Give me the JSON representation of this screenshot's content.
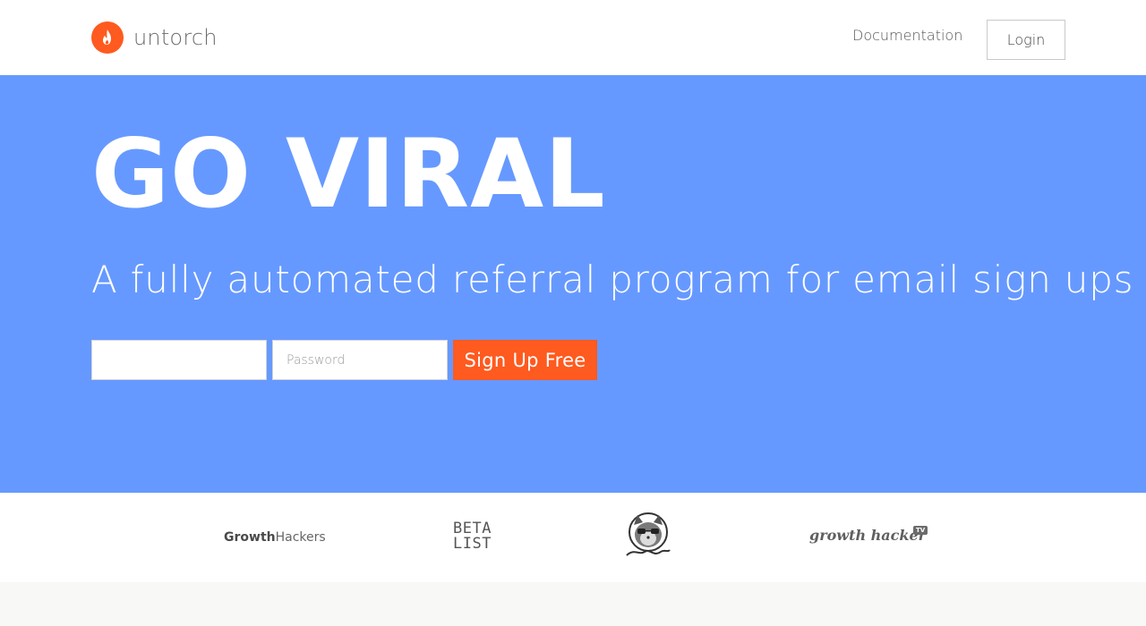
{
  "header": {
    "brand_name": "untorch",
    "nav": {
      "documentation": "Documentation",
      "login": "Login"
    }
  },
  "hero": {
    "title": "GO VIRAL",
    "subtitle": "A fully automated referral program for email sign ups",
    "form": {
      "email_value": "",
      "email_placeholder": "",
      "password_placeholder": "Password",
      "submit_label": "Sign Up Free"
    }
  },
  "featured_logos": {
    "growthhackers": {
      "bold": "Growth",
      "light": "Hackers"
    },
    "betalist": {
      "line1": "BETA",
      "line2": "LIST"
    },
    "producthunt": {
      "icon": "product-hunt-cat-logo"
    },
    "growthhackertv": {
      "text": "growth hacker",
      "badge": "TV"
    }
  },
  "colors": {
    "brand_orange": "#ff5a1f",
    "hero_blue": "#6699ff",
    "page_bg": "#f8f8f6"
  }
}
